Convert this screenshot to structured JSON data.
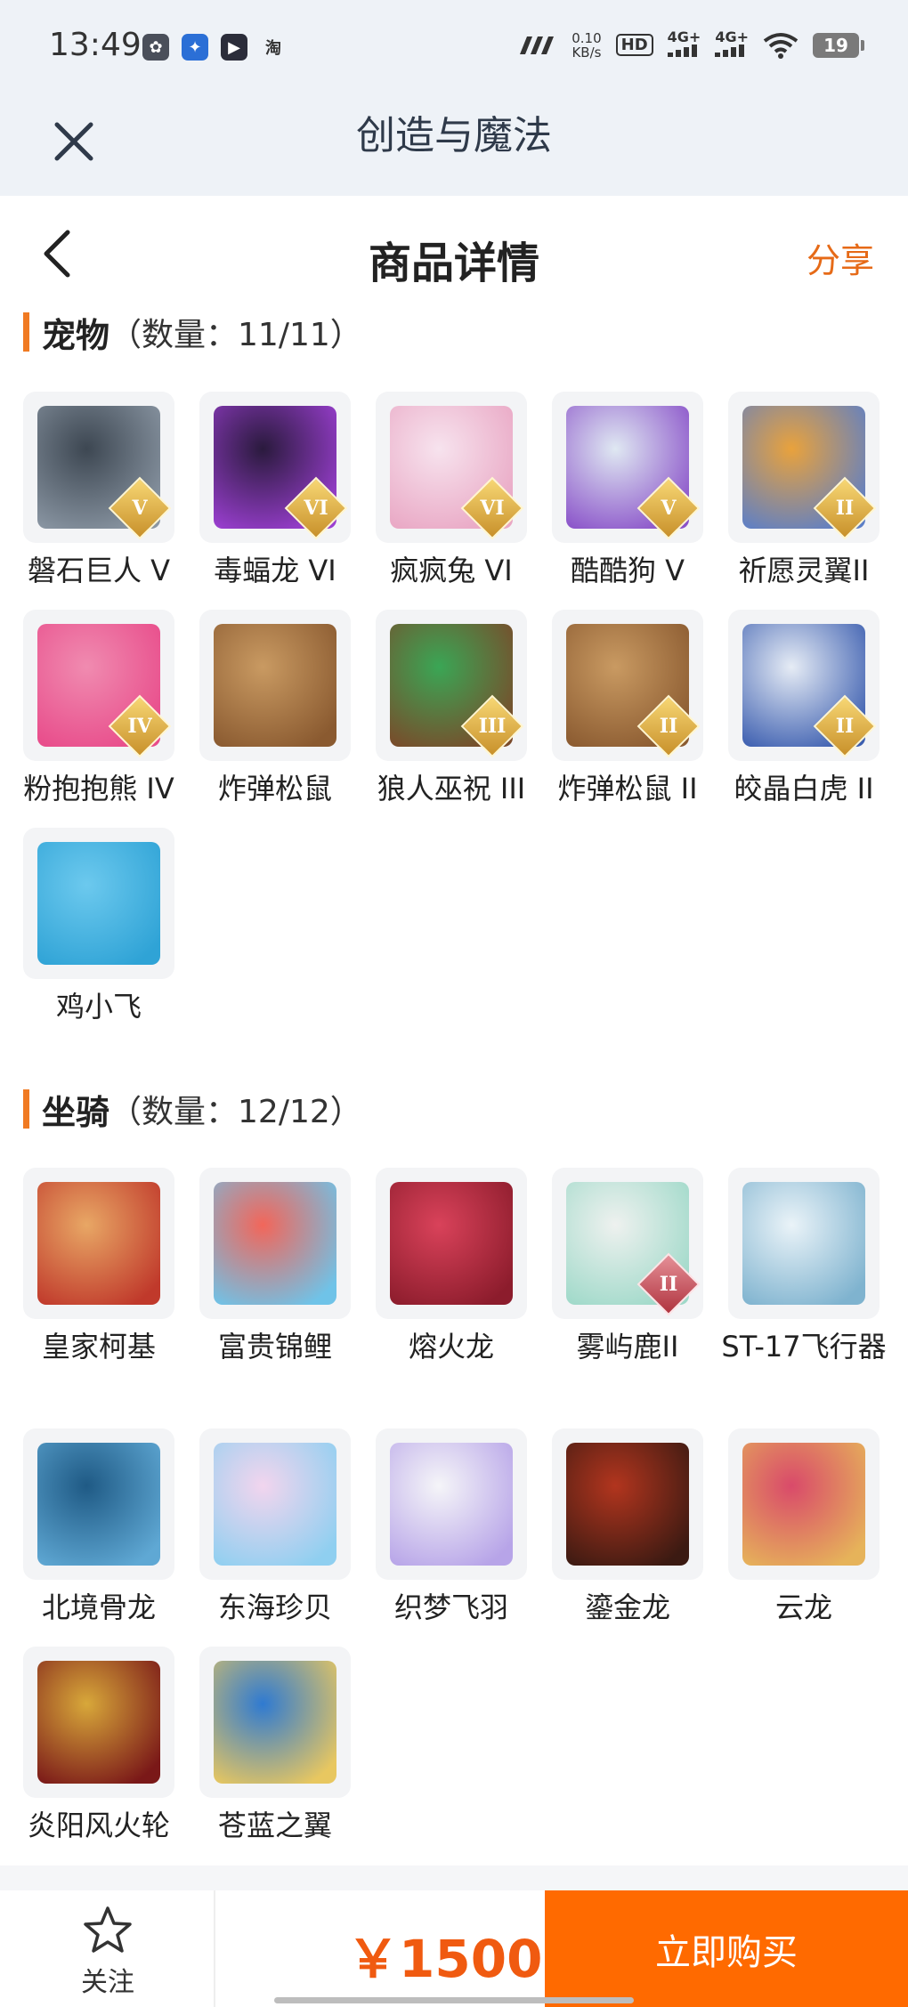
{
  "status_bar": {
    "time": "13:49",
    "app_icons": [
      {
        "icon": "gallery-app-icon",
        "color": "#4a4f5a",
        "glyph": "✿"
      },
      {
        "icon": "telecom-app-icon",
        "color": "#2b6fd6",
        "glyph": "✦"
      },
      {
        "icon": "video-app-icon",
        "color": "#2b2d3a",
        "glyph": "▶"
      },
      {
        "icon": "taobao-app-icon",
        "color": "transparent",
        "glyph": "淘"
      }
    ],
    "speed_value": "0.10",
    "speed_unit": "KB/s",
    "hd_badge": "HD",
    "network_1": "4G+",
    "network_2": "4G+",
    "battery": "19"
  },
  "app_header": {
    "title": "创造与魔法"
  },
  "page_header": {
    "title": "商品详情",
    "share_label": "分享"
  },
  "pets": {
    "name": "宠物",
    "count": "（数量：11/11）",
    "items": [
      {
        "name": "磐石巨人 V",
        "roman": "V",
        "colors": [
          "#3d4752",
          "#8a96a3"
        ]
      },
      {
        "name": "毒蝠龙 VI",
        "roman": "VI",
        "colors": [
          "#2a1a3d",
          "#9b3fd1"
        ]
      },
      {
        "name": "疯疯兔 VI",
        "roman": "VI",
        "colors": [
          "#f7e3ee",
          "#e9a7c4"
        ]
      },
      {
        "name": "酷酷狗 V",
        "roman": "V",
        "colors": [
          "#dfe8f2",
          "#8a52c9"
        ]
      },
      {
        "name": "祈愿灵翼II",
        "roman": "II",
        "colors": [
          "#e9a23c",
          "#5d7fc7"
        ]
      },
      {
        "name": "粉抱抱熊 IV",
        "roman": "IV",
        "colors": [
          "#f08bb0",
          "#e84b8a"
        ]
      },
      {
        "name": "炸弹松鼠",
        "roman": "",
        "colors": [
          "#c99a62",
          "#8a5a30"
        ]
      },
      {
        "name": "狼人巫祝 III",
        "roman": "III",
        "colors": [
          "#3aa655",
          "#7a4a2a"
        ]
      },
      {
        "name": "炸弹松鼠 II",
        "roman": "II",
        "colors": [
          "#c99a62",
          "#8a5a30"
        ]
      },
      {
        "name": "皎晶白虎 II",
        "roman": "II",
        "colors": [
          "#e6ecf5",
          "#3d5fb0"
        ]
      },
      {
        "name": "鸡小飞",
        "roman": "",
        "colors": [
          "#6cc9ee",
          "#2fa3d6"
        ]
      }
    ]
  },
  "mounts": {
    "name": "坐骑",
    "count": "（数量：12/12）",
    "items": [
      {
        "name": "皇家柯基",
        "roman": "",
        "colors": [
          "#e8a765",
          "#c0392b"
        ]
      },
      {
        "name": "富贵锦鲤",
        "roman": "",
        "colors": [
          "#f2665a",
          "#6fc3e8"
        ]
      },
      {
        "name": "熔火龙",
        "roman": "",
        "colors": [
          "#d9425a",
          "#8c1c2c"
        ]
      },
      {
        "name": "雾屿鹿II",
        "roman": "II",
        "colors": [
          "#eef1ef",
          "#9fd9c9"
        ]
      },
      {
        "name": "ST-17飞行器",
        "roman": "",
        "colors": [
          "#eaf3f8",
          "#7fb3cf"
        ]
      },
      {
        "name": "北境骨龙",
        "roman": "",
        "colors": [
          "#1f5a85",
          "#5fa8d4"
        ]
      },
      {
        "name": "东海珍贝",
        "roman": "",
        "colors": [
          "#f2d5ee",
          "#8fcff0"
        ]
      },
      {
        "name": "织梦飞羽",
        "roman": "",
        "colors": [
          "#f5f5f8",
          "#b7a4e8"
        ]
      },
      {
        "name": "鎏金龙",
        "roman": "",
        "colors": [
          "#b2351e",
          "#3b1a12"
        ]
      },
      {
        "name": "云龙",
        "roman": "",
        "colors": [
          "#d94a6a",
          "#e6b35a"
        ]
      },
      {
        "name": "炎阳风火轮",
        "roman": "",
        "colors": [
          "#d8a83a",
          "#7a1818"
        ]
      },
      {
        "name": "苍蓝之翼",
        "roman": "",
        "colors": [
          "#2f7ad1",
          "#e8c760"
        ]
      }
    ]
  },
  "bottom_bar": {
    "follow_label": "关注",
    "price": "￥1500",
    "buy_label": "立即购买"
  },
  "colors": {
    "accent": "#ff6a00",
    "price": "#f05a10",
    "share": "#e66a17",
    "section_bar": "#f07a22"
  }
}
